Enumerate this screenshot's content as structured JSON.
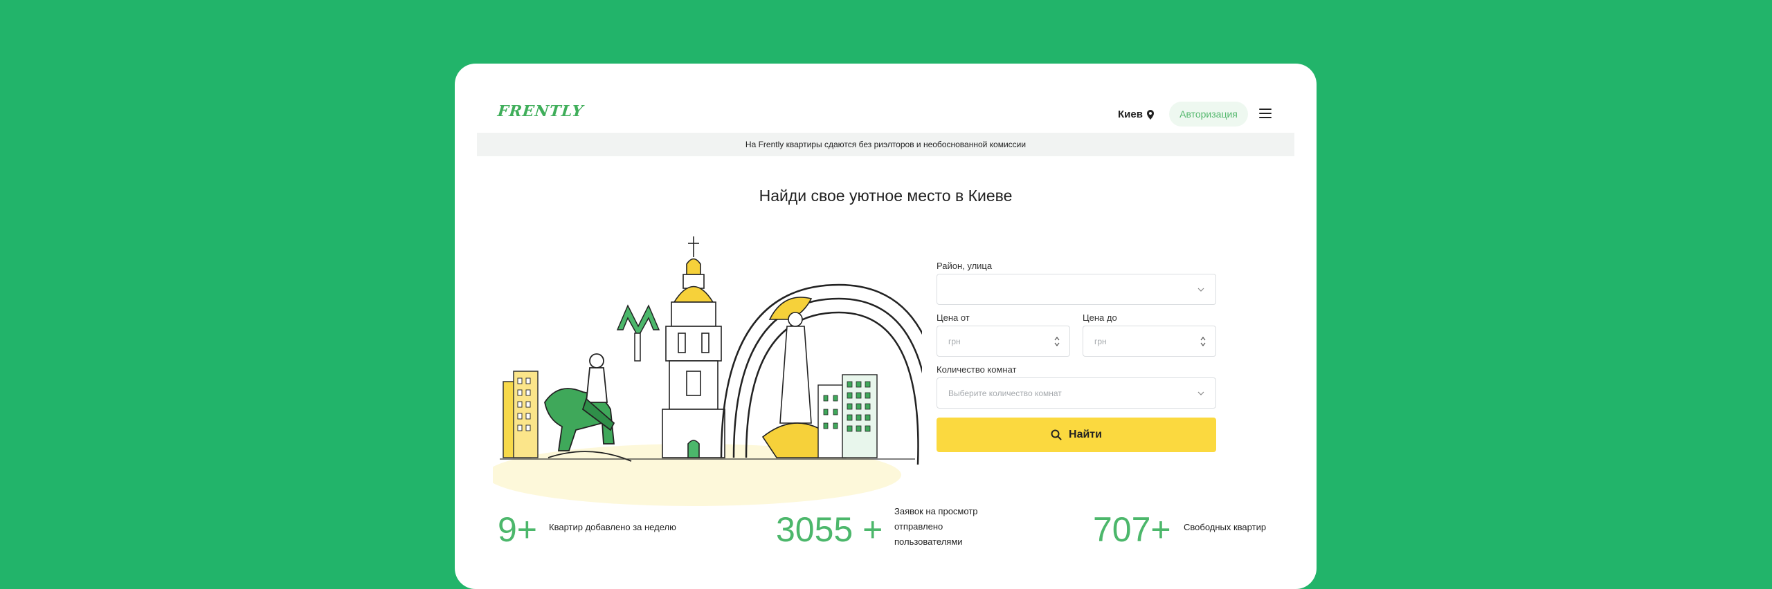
{
  "header": {
    "logo_text": "FRENTLY",
    "city": "Киев",
    "auth_label": "Авторизация"
  },
  "banner": {
    "text": "На Frently квартиры сдаются без риэлторов и необоснованной комиссии"
  },
  "hero": {
    "title": "Найди свое уютное место в Киеве"
  },
  "search_form": {
    "district_label": "Район, улица",
    "district_value": "",
    "price_from_label": "Цена от",
    "price_from_placeholder": "грн",
    "price_to_label": "Цена до",
    "price_to_placeholder": "грн",
    "rooms_label": "Количество комнат",
    "rooms_placeholder": "Выберите количество комнат",
    "submit_label": "Найти"
  },
  "stats": [
    {
      "number": "9+",
      "text_lines": [
        "Квартир добавлено за неделю"
      ]
    },
    {
      "number": "3055 +",
      "text_lines": [
        "Заявок на просмотр",
        "отправлено",
        "пользователями"
      ]
    },
    {
      "number": "707+",
      "text_lines": [
        "Свободных квартир"
      ]
    }
  ],
  "colors": {
    "background": "#22b46a",
    "brand_green": "#4cb76b",
    "accent_yellow": "#fbd93f"
  },
  "icons": {
    "city_marker": "location-pin-icon",
    "menu": "hamburger-menu-icon",
    "search": "search-icon"
  }
}
